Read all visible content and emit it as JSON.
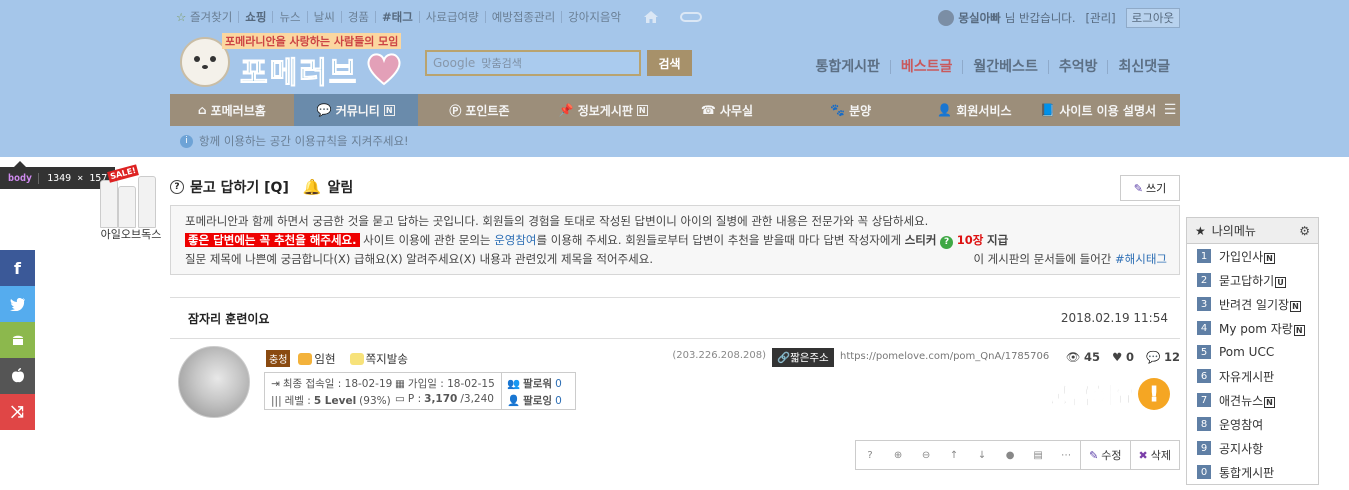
{
  "topbar": {
    "links": [
      "즐겨찾기",
      "쇼핑",
      "뉴스",
      "날씨",
      "경품",
      "#태그",
      "사료급여량",
      "예방접종관리",
      "강아지음악"
    ],
    "user_name": "몽실아빠",
    "greeting": "님 반갑습니다.",
    "admin": "[관리]",
    "logout": "로그아웃"
  },
  "logo": {
    "tagline": "포메라니안을 사랑하는 사람들의 모임",
    "name": "포메러브"
  },
  "search": {
    "placeholder_brand": "Google",
    "placeholder": "맞춤검색",
    "button": "검색"
  },
  "quick_links": [
    "통합게시판",
    "베스트글",
    "월간베스트",
    "추억방",
    "최신댓글"
  ],
  "nav": [
    "포메러브홈",
    "커뮤니티",
    "포인트존",
    "정보게시판",
    "사무실",
    "분양",
    "회원서비스",
    "사이트 이용 설명서"
  ],
  "notice": "항께 이용하는 공간 이용규칙을 지켜주세요!",
  "devtools": {
    "tag": "body",
    "size": "1349 × 157"
  },
  "ad": {
    "sale": "SALE!",
    "label": "아일오브독스"
  },
  "board": {
    "title": "묻고 답하기 [Q]",
    "alarm": "알림",
    "write": "쓰기",
    "desc_line1": "포메라니안과 함께 하면서 궁금한 것을 묻고 답하는 곳입니다. 회원들의 경험을 토대로 작성된 답변이니 아이의 질병에 관한 내용은 전문가와 꼭 상담하세요.",
    "desc_red": "좋은 답변에는 꼭 추천을 해주세요.",
    "desc_line2a": " 사이트 이용에 관한 문의는 ",
    "desc_link": "운영참여",
    "desc_line2b": "를 이용해 주세요. 회원들로부터 답변이 추천을 받을때 마다 답변 작성자에게 ",
    "desc_sticker": "스티커",
    "desc_count": "10장",
    "desc_give": "지급",
    "desc_line3": "질문 제목에 나쁜예 궁금합니다(X) 급해요(X) 알려주세요(X) 내용과 관련있게 제목을 적어주세요.",
    "desc_tag_text": "이 게시판의 문서들에 들어간 ",
    "desc_tag_link": "#해시태그"
  },
  "post": {
    "title": "잠자리 훈련이요",
    "date": "2018.02.19 11:54",
    "rank": "충청",
    "author": "임현",
    "message": "쪽지발송",
    "last_login": "최종 접속일 : 18-02-19",
    "joined": "가입일 : 18-02-15",
    "level_label": "레벨 : ",
    "level": "5 Level",
    "level_pct": "(93%)",
    "points_label": "P : ",
    "points": "3,170",
    "points_max": "/3,240",
    "follower_label": "팔로워",
    "follower": "0",
    "following_label": "팔로잉",
    "following": "0",
    "ip": "(203.226.208.208)",
    "short": "짧은주소",
    "url": "https://pomelove.com/pom_QnA/1785706",
    "views": "45",
    "likes": "0",
    "comments": "12",
    "sticker_text": "궁금해요"
  },
  "toolbar": {
    "edit": "수정",
    "delete": "삭제"
  },
  "mymenu": {
    "title": "나의메뉴",
    "items": [
      {
        "num": "1",
        "label": "가입인사",
        "badge": "N"
      },
      {
        "num": "2",
        "label": "묻고답하기",
        "badge": "U"
      },
      {
        "num": "3",
        "label": "반려견 일기장",
        "badge": "N"
      },
      {
        "num": "4",
        "label": "My pom 자랑",
        "badge": "N"
      },
      {
        "num": "5",
        "label": "Pom UCC",
        "badge": ""
      },
      {
        "num": "6",
        "label": "자유게시판",
        "badge": ""
      },
      {
        "num": "7",
        "label": "애견뉴스",
        "badge": "N"
      },
      {
        "num": "8",
        "label": "운영참여",
        "badge": ""
      },
      {
        "num": "9",
        "label": "공지사항",
        "badge": ""
      },
      {
        "num": "0",
        "label": "통합게시판",
        "badge": ""
      }
    ]
  },
  "colors": {
    "highlight": "#a5c6ea",
    "nav": "#9c8e7a",
    "nav_active": "#6a8bab",
    "menu_num": "#5f7fa5"
  }
}
